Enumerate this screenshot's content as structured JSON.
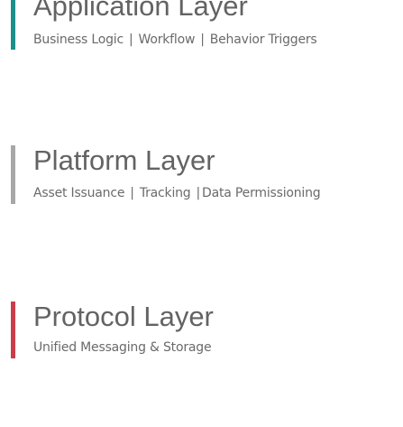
{
  "colors": {
    "application_bar": "#1a8f8c",
    "platform_bar": "#a7a7a7",
    "protocol_bar": "#cc3d4a",
    "title_text": "#636363",
    "subtitle_text": "#6a6a6a"
  },
  "layers": [
    {
      "title": "Application Layer",
      "items": [
        "Business Logic",
        "Workflow",
        "Behavior Triggers"
      ]
    },
    {
      "title": "Platform Layer",
      "items": [
        "Asset Issuance",
        "Tracking",
        "Data Permissioning"
      ]
    },
    {
      "title": "Protocol Layer",
      "items": [
        "Unified Messaging & Storage"
      ]
    }
  ],
  "separator": "|"
}
